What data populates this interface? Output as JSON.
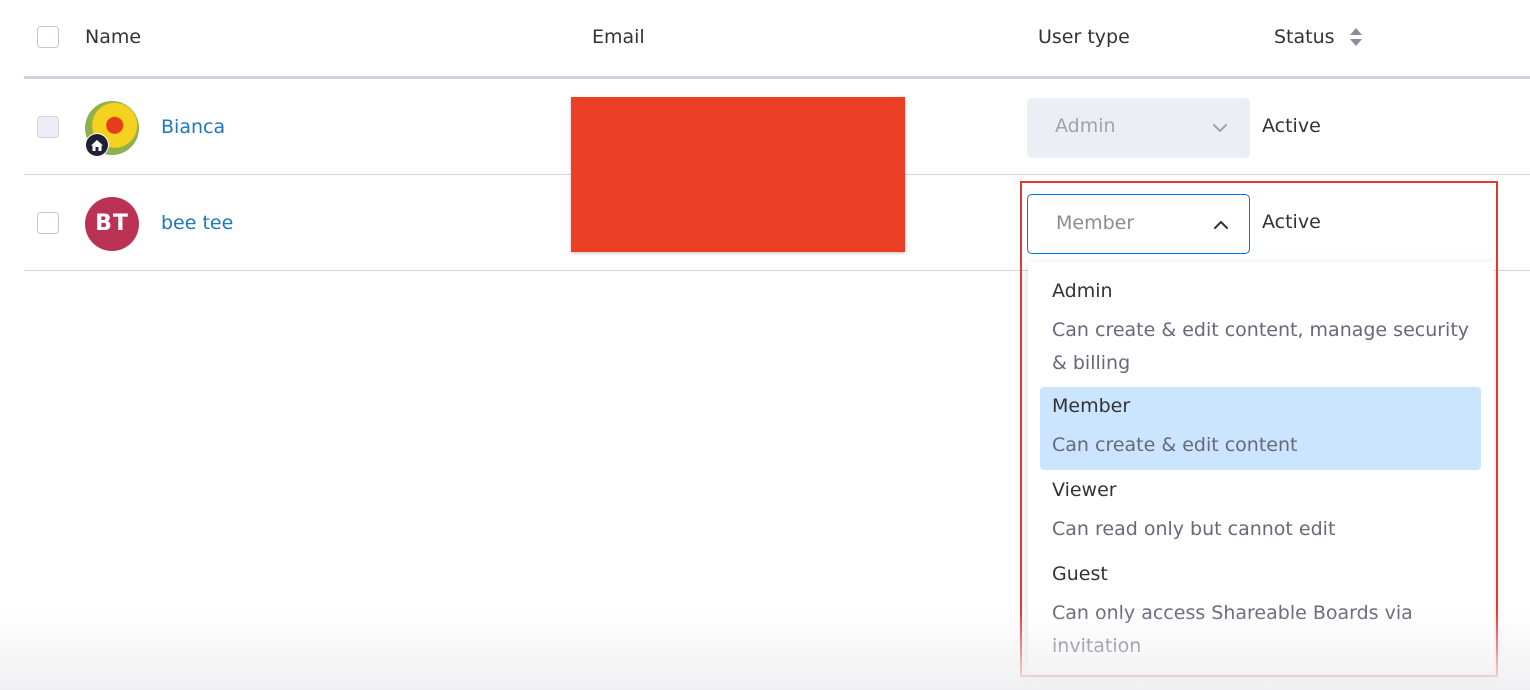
{
  "header": {
    "name": "Name",
    "email": "Email",
    "user_type": "User type",
    "status": "Status"
  },
  "rows": [
    {
      "name": "Bianca",
      "user_type": "Admin",
      "status": "Active",
      "avatar": "photo-with-home-badge"
    },
    {
      "name": "bee tee",
      "initials": "BT",
      "user_type": "Member",
      "status": "Active",
      "avatar_color": "#bb3354"
    }
  ],
  "dropdown": {
    "selected": "Member",
    "options": [
      {
        "title": "Admin",
        "description": "Can create & edit content, manage security & billing"
      },
      {
        "title": "Member",
        "description": "Can create & edit content"
      },
      {
        "title": "Viewer",
        "description": "Can read only but cannot edit"
      },
      {
        "title": "Guest",
        "description": "Can only access Shareable Boards via invitation"
      }
    ]
  },
  "colors": {
    "link": "#1f76c2",
    "selected_option_bg": "#cce5ff",
    "focus_border": "#0073ea",
    "redaction": "#eb4025",
    "highlight_frame": "#e0392f"
  },
  "icons": {
    "sort": "sort-icon",
    "chevron_down": "chevron-down-icon",
    "chevron_up": "chevron-up-icon",
    "home": "home-icon"
  }
}
